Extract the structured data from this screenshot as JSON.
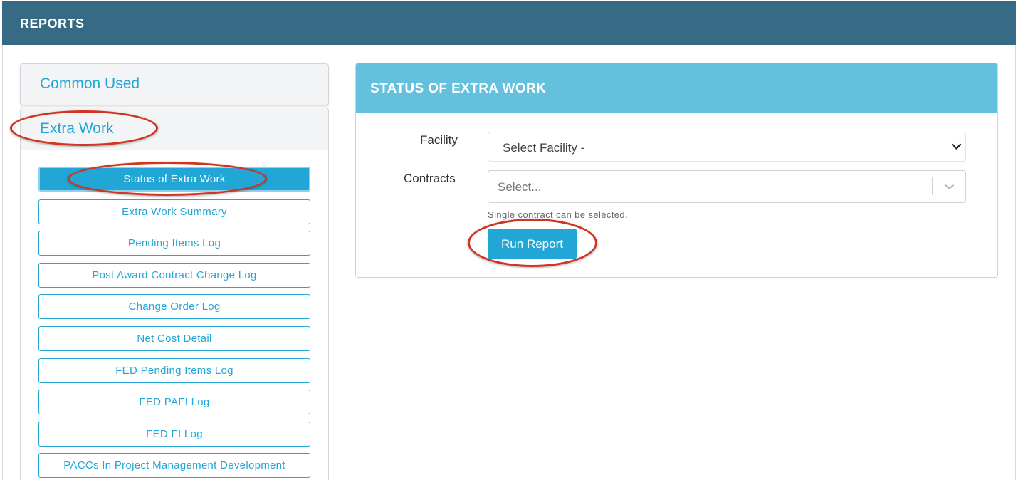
{
  "header": {
    "title": "REPORTS"
  },
  "sidebar": {
    "sections": [
      {
        "label": "Common Used"
      },
      {
        "label": "Extra Work"
      }
    ],
    "reports": [
      {
        "label": "Status of Extra Work",
        "active": true
      },
      {
        "label": "Extra Work Summary"
      },
      {
        "label": "Pending Items Log"
      },
      {
        "label": "Post Award Contract Change Log"
      },
      {
        "label": "Change Order Log"
      },
      {
        "label": "Net Cost Detail"
      },
      {
        "label": "FED Pending Items Log"
      },
      {
        "label": "FED PAFI Log"
      },
      {
        "label": "FED FI Log"
      },
      {
        "label": "PACCs In Project Management Development"
      }
    ]
  },
  "panel": {
    "title": "STATUS OF EXTRA WORK",
    "facility": {
      "label": "Facility",
      "value": "Select Facility -"
    },
    "contracts": {
      "label": "Contracts",
      "placeholder": "Select...",
      "help": "Single contract can be selected."
    },
    "run_button": "Run Report"
  },
  "colors": {
    "header": "#376b85",
    "accent": "#21a6d6",
    "panel_header": "#64c1dd",
    "annotation": "#d1341f"
  },
  "icons": {
    "facility_dropdown": "chevron-down-icon",
    "contracts_dropdown": "chevron-down-icon"
  }
}
